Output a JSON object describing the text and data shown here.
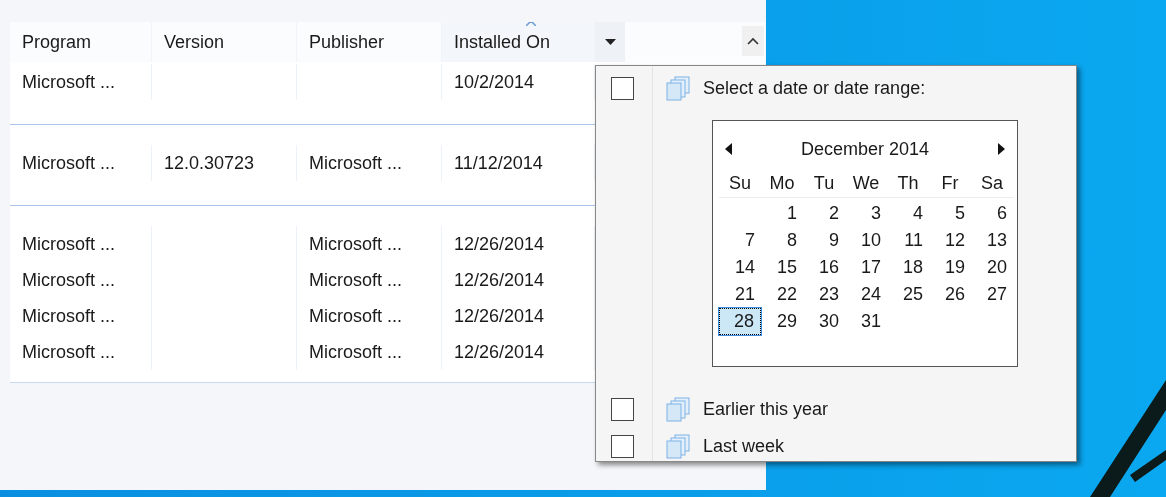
{
  "table": {
    "columns": [
      {
        "label": "Program",
        "sorted": false,
        "filter_open": false
      },
      {
        "label": "Version",
        "sorted": false,
        "filter_open": false
      },
      {
        "label": "Publisher",
        "sorted": false,
        "filter_open": false
      },
      {
        "label": "Installed On",
        "sorted": true,
        "filter_open": true
      }
    ],
    "groups": [
      {
        "rows": [
          {
            "program": "Microsoft ...",
            "installed_on": "10/2/2014"
          }
        ]
      },
      {
        "rows": [
          {
            "program": "Microsoft ...",
            "version": "12.0.30723",
            "publisher": "Microsoft ...",
            "installed_on": "11/12/2014"
          }
        ]
      },
      {
        "rows": [
          {
            "program": "Microsoft ...",
            "publisher": "Microsoft ...",
            "installed_on": "12/26/2014"
          },
          {
            "program": "Microsoft ...",
            "publisher": "Microsoft ...",
            "installed_on": "12/26/2014"
          },
          {
            "program": "Microsoft ...",
            "publisher": "Microsoft ...",
            "installed_on": "12/26/2014"
          },
          {
            "program": "Microsoft ...",
            "publisher": "Microsoft ...",
            "installed_on": "12/26/2014"
          }
        ]
      }
    ]
  },
  "filter_popup": {
    "options": [
      {
        "kind": "date-picker",
        "label": "Select a date or date range:",
        "checked": false
      },
      {
        "kind": "option",
        "label": "Earlier this year",
        "checked": false
      },
      {
        "kind": "option",
        "label": "Last week",
        "checked": false
      }
    ],
    "calendar": {
      "month": "December 2014",
      "weekdays": [
        "Su",
        "Mo",
        "Tu",
        "We",
        "Th",
        "Fr",
        "Sa"
      ],
      "weeks": [
        {
          "kind": "partial-start",
          "days": [
            {
              "label": "1",
              "selected": false
            },
            {
              "label": "2",
              "selected": false
            },
            {
              "label": "3",
              "selected": false
            },
            {
              "label": "4",
              "selected": false
            },
            {
              "label": "5",
              "selected": false
            },
            {
              "label": "6",
              "selected": false
            }
          ]
        },
        {
          "kind": "full",
          "days": [
            {
              "label": "7",
              "selected": false
            },
            {
              "label": "8",
              "selected": false
            },
            {
              "label": "9",
              "selected": false
            },
            {
              "label": "10",
              "selected": false
            },
            {
              "label": "11",
              "selected": false
            },
            {
              "label": "12",
              "selected": false
            },
            {
              "label": "13",
              "selected": false
            }
          ]
        },
        {
          "kind": "full",
          "days": [
            {
              "label": "14",
              "selected": false
            },
            {
              "label": "15",
              "selected": false
            },
            {
              "label": "16",
              "selected": false
            },
            {
              "label": "17",
              "selected": false
            },
            {
              "label": "18",
              "selected": false
            },
            {
              "label": "19",
              "selected": false
            },
            {
              "label": "20",
              "selected": false
            }
          ]
        },
        {
          "kind": "full",
          "days": [
            {
              "label": "21",
              "selected": false
            },
            {
              "label": "22",
              "selected": false
            },
            {
              "label": "23",
              "selected": false
            },
            {
              "label": "24",
              "selected": false
            },
            {
              "label": "25",
              "selected": false
            },
            {
              "label": "26",
              "selected": false
            },
            {
              "label": "27",
              "selected": false
            }
          ]
        },
        {
          "kind": "partial-end",
          "days": [
            {
              "label": "28",
              "selected": true
            },
            {
              "label": "29",
              "selected": false
            },
            {
              "label": "30",
              "selected": false
            },
            {
              "label": "31",
              "selected": false
            }
          ]
        }
      ]
    }
  }
}
